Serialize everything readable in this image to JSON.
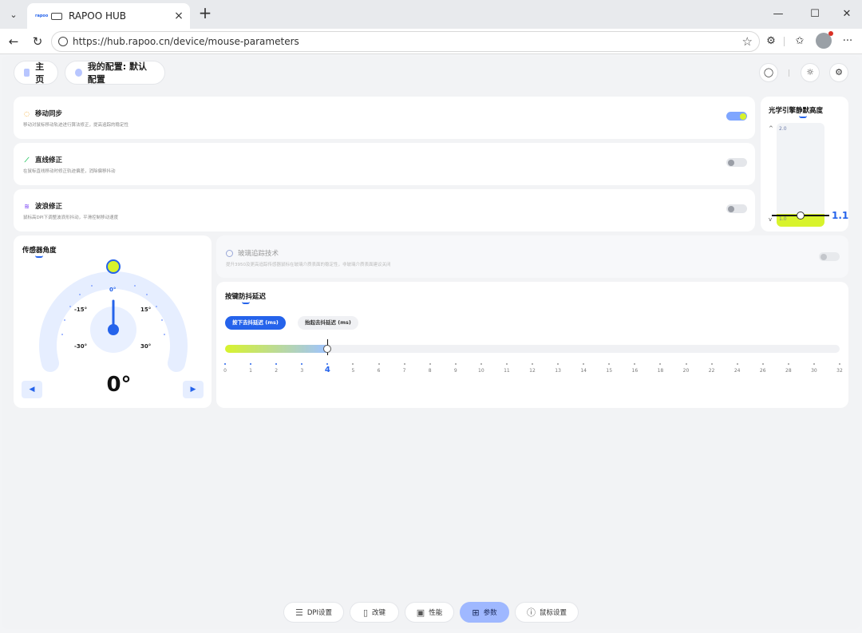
{
  "browser": {
    "tab_title": "RAPOO HUB",
    "favicon_text": "rapoo",
    "url": "https://hub.rapoo.cn/device/mouse-parameters"
  },
  "header": {
    "home_label": "主页",
    "config_label": "我的配置: 默认配置"
  },
  "rows": [
    {
      "title": "移动同步",
      "desc": "移动对鼠标移动轨迹进行算法修正，提高追踪的稳定性",
      "enabled": true,
      "icon": "sync-icon",
      "icon_color": "#f59e0b"
    },
    {
      "title": "直线修正",
      "desc": "在鼠标直线移动时修正轨迹偏差，消除偏移抖动",
      "enabled": false,
      "icon": "line-correction-icon",
      "icon_color": "#22c55e"
    },
    {
      "title": "波浪修正",
      "desc": "鼠标高DPI下调整波浪形抖动，平滑控制移动速度",
      "enabled": false,
      "icon": "wave-icon",
      "icon_color": "#8b5cf6"
    }
  ],
  "lod": {
    "title": "光学引擎静默高度",
    "top_label": "2.0",
    "bottom_label": "1.0",
    "value": "1.1",
    "arrow_up": "^",
    "arrow_down": "v"
  },
  "sensor": {
    "title": "传感器角度",
    "labels": [
      "0°",
      "15°",
      "-15°",
      "30°",
      "-30°"
    ],
    "value": "0°"
  },
  "glass": {
    "title": "玻璃追踪技术",
    "desc": "提升3950及更高追踪传感器鼠标在玻璃介质表面的稳定性，非玻璃介质表面建议关闭",
    "enabled": false
  },
  "debounce": {
    "title": "按键防抖延迟",
    "tab_press": "按下去抖延迟 (ms)",
    "tab_release": "抬起去抖延迟 (ms)",
    "value": 4,
    "min": 0,
    "max": 32,
    "tick_labels": [
      "0",
      "1",
      "2",
      "3",
      "4",
      "5",
      "6",
      "7",
      "8",
      "9",
      "10",
      "11",
      "12",
      "13",
      "14",
      "15",
      "16",
      "18",
      "20",
      "22",
      "24",
      "26",
      "28",
      "30",
      "32"
    ]
  },
  "bottom_nav": [
    {
      "label": "DPI设置",
      "icon": "dpi-icon",
      "active": false
    },
    {
      "label": "改键",
      "icon": "mouse-icon",
      "active": false
    },
    {
      "label": "性能",
      "icon": "performance-icon",
      "active": false
    },
    {
      "label": "参数",
      "icon": "grid-icon",
      "active": true
    },
    {
      "label": "鼠标设置",
      "icon": "info-icon",
      "active": false
    }
  ],
  "colors": {
    "accent": "#2563eb",
    "lime": "#d8f32c",
    "toggle_on": "#7fa6ff"
  }
}
